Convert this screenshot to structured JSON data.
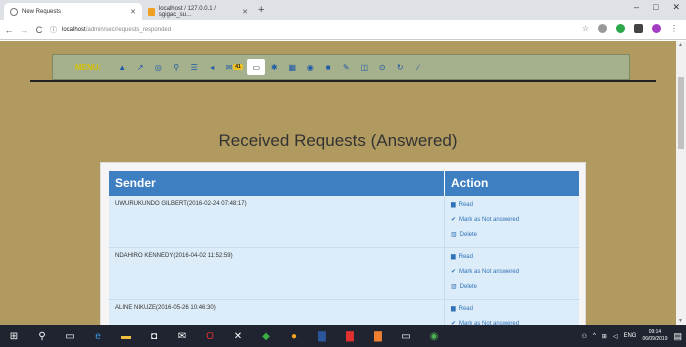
{
  "browser": {
    "tabs": [
      {
        "label": "New Requests",
        "active": true
      },
      {
        "label": "localhost / 127.0.0.1 / sgigac_su…",
        "active": false
      }
    ],
    "url_host": "localhost",
    "url_path": "/admin/sec/requests_responded",
    "window_controls": [
      "–",
      "□",
      "✕"
    ]
  },
  "menu": {
    "label": "MENU:",
    "badge": "41",
    "items": [
      "alert-icon",
      "wrench-icon",
      "target-icon",
      "search-icon",
      "list-icon",
      "send-icon",
      "inbox-icon",
      "outbox-icon",
      "gear-icon",
      "grid-icon",
      "eye-icon",
      "flag-icon",
      "edit-icon",
      "comment-icon",
      "cog-icon",
      "refresh-icon",
      "pencil-icon"
    ]
  },
  "page": {
    "title": "Received Requests (Answered)"
  },
  "table": {
    "headers": {
      "sender": "Sender",
      "action": "Action"
    },
    "actions": {
      "read": "Read",
      "mark": "Mark as Not answered",
      "delete": "Delete"
    },
    "rows": [
      {
        "sender": "UWURUKUNDO GILBERT(2016-02-24 07:48:17)"
      },
      {
        "sender": "NDAHIRO KENNEDY(2016-04-02 11:52:59)"
      },
      {
        "sender": "ALINE NIKUZE(2016-05-26 10:46:30)"
      }
    ]
  },
  "taskbar": {
    "time": "09:14",
    "date": "06/09/2019",
    "lang": "ENG"
  },
  "colors": {
    "page_bg": "#b09a5f",
    "menu_bg": "#a5b08c",
    "header_blue": "#3d7fc1",
    "row_bg": "#dcecf8",
    "link_blue": "#2f72b8"
  }
}
